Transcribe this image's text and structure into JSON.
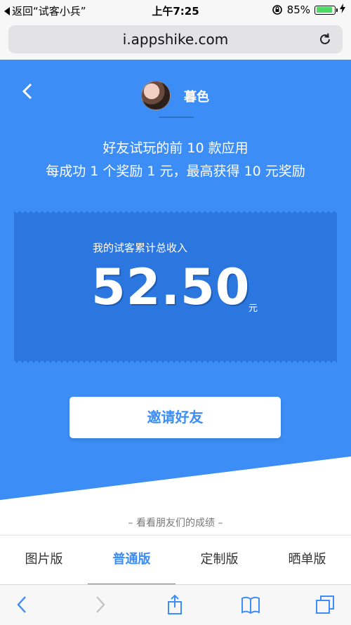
{
  "status_bar": {
    "back_to_app": "返回“试客小兵”",
    "time": "上午7:25",
    "battery_percent": "85%",
    "battery_level": 0.85,
    "icons": [
      "lock-rotation-icon",
      "battery-icon",
      "charging-icon"
    ]
  },
  "browser": {
    "url": "i.appshike.com",
    "reload_icon": "reload-icon"
  },
  "header": {
    "username": "暮色",
    "avatar": "avatar-photo"
  },
  "description": {
    "line1": "好友试玩的前 10 款应用",
    "line2": "每成功 1 个奖励 1 元，最高获得 10 元奖励"
  },
  "earnings": {
    "label": "我的试客累计总收入",
    "amount": "52.50",
    "unit": "元"
  },
  "invite_button": {
    "label": "邀请好友"
  },
  "friends_caption": "– 看看朋友们的成绩 –",
  "tabs": [
    {
      "label": "图片版",
      "active": false
    },
    {
      "label": "普通版",
      "active": true
    },
    {
      "label": "定制版",
      "active": false
    },
    {
      "label": "晒单版",
      "active": false
    }
  ],
  "toolbar_icons": [
    "back-icon",
    "forward-icon",
    "share-icon",
    "bookmarks-icon",
    "tabs-icon"
  ],
  "colors": {
    "primary_blue": "#3c8df5",
    "card_blue": "#2c76e0",
    "battery_green": "#4cd964"
  }
}
